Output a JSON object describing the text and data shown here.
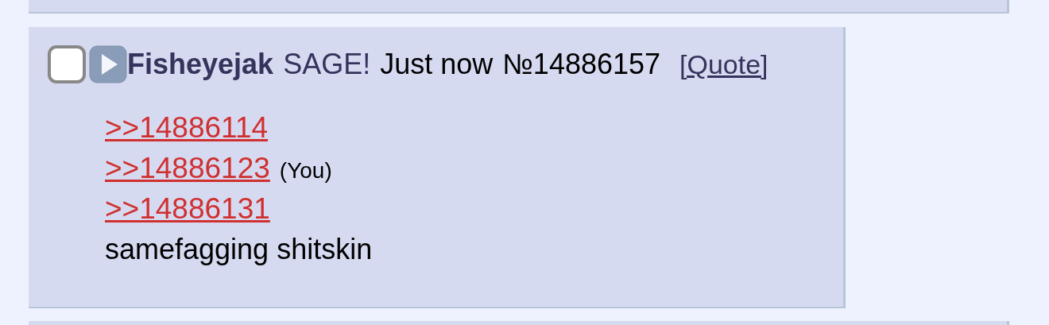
{
  "post": {
    "checked": false,
    "name": "Fisheyejak",
    "email": "SAGE!",
    "time": "Just now",
    "number": "№14886157",
    "quote": "[Quote]",
    "replies": [
      {
        "link": ">>14886114"
      },
      {
        "link": ">>14886123",
        "note": "(You)"
      },
      {
        "link": ">>14886131"
      }
    ],
    "message": "samefagging shitskin"
  }
}
